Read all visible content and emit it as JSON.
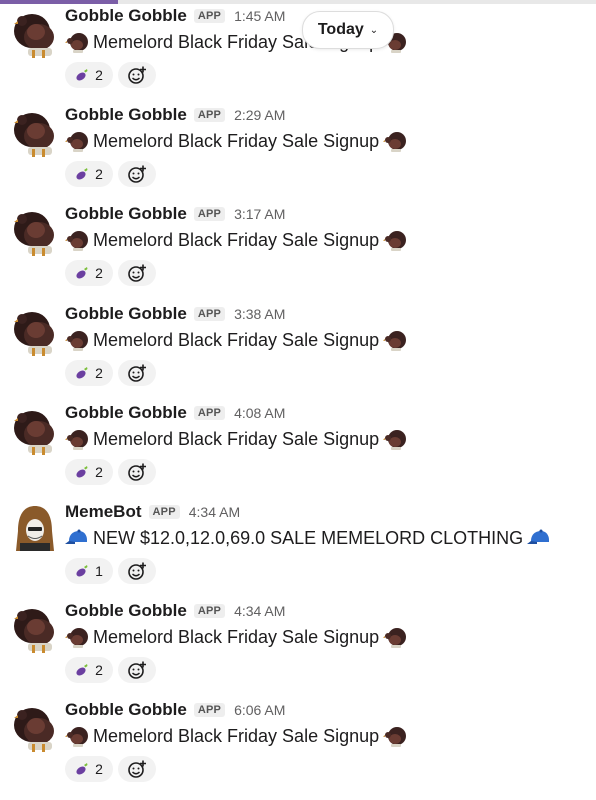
{
  "date_divider": {
    "label": "Today"
  },
  "messages": [
    {
      "sender": "Gobble Gobble",
      "badge": "APP",
      "time": "1:45 AM",
      "text": "Memelord Black Friday Sale Signup",
      "emoji": "turkey",
      "reaction_count": "2",
      "avatar": "turkey"
    },
    {
      "sender": "Gobble Gobble",
      "badge": "APP",
      "time": "2:29 AM",
      "text": "Memelord Black Friday Sale Signup",
      "emoji": "turkey",
      "reaction_count": "2",
      "avatar": "turkey"
    },
    {
      "sender": "Gobble Gobble",
      "badge": "APP",
      "time": "3:17 AM",
      "text": "Memelord Black Friday Sale Signup",
      "emoji": "turkey",
      "reaction_count": "2",
      "avatar": "turkey"
    },
    {
      "sender": "Gobble Gobble",
      "badge": "APP",
      "time": "3:38 AM",
      "text": "Memelord Black Friday Sale Signup",
      "emoji": "turkey",
      "reaction_count": "2",
      "avatar": "turkey"
    },
    {
      "sender": "Gobble Gobble",
      "badge": "APP",
      "time": "4:08 AM",
      "text": "Memelord Black Friday Sale Signup",
      "emoji": "turkey",
      "reaction_count": "2",
      "avatar": "turkey"
    },
    {
      "sender": "MemeBot",
      "badge": "APP",
      "time": "4:34 AM",
      "text": "NEW $12.0,12.0,69.0 SALE MEMELORD CLOTHING",
      "emoji": "cap",
      "reaction_count": "1",
      "avatar": "hooded-figure"
    },
    {
      "sender": "Gobble Gobble",
      "badge": "APP",
      "time": "4:34 AM",
      "text": "Memelord Black Friday Sale Signup",
      "emoji": "turkey",
      "reaction_count": "2",
      "avatar": "turkey"
    },
    {
      "sender": "Gobble Gobble",
      "badge": "APP",
      "time": "6:06 AM",
      "text": "Memelord Black Friday Sale Signup",
      "emoji": "turkey",
      "reaction_count": "2",
      "avatar": "turkey"
    }
  ],
  "reaction_emoji": "eggplant",
  "colors": {
    "accent": "#7b5ea7",
    "turkey": "#3b2220",
    "cap": "#2f6fd0",
    "eggplant": "#6b3fa0"
  }
}
